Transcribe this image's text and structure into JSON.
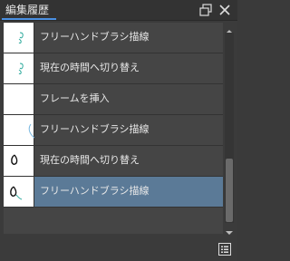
{
  "panel": {
    "title": "編集履歴"
  },
  "history": {
    "items": [
      {
        "label": "フリーハンドブラシ描線",
        "thumb": "small-green-stroke",
        "selected": false
      },
      {
        "label": "現在の時間へ切り替え",
        "thumb": "small-green-stroke",
        "selected": false
      },
      {
        "label": "フレームを挿入",
        "thumb": "blank",
        "selected": false
      },
      {
        "label": "フリーハンドブラシ描線",
        "thumb": "blue-curve",
        "selected": false
      },
      {
        "label": "現在の時間へ切り替え",
        "thumb": "black-loop",
        "selected": false
      },
      {
        "label": "フリーハンドブラシ描線",
        "thumb": "black-loop-with-stroke",
        "selected": true
      }
    ]
  },
  "colors": {
    "accent": "#4a90e2",
    "selected_row": "#5b7a97",
    "panel_bg": "#3b3b3b"
  },
  "icons": {
    "restore": "restore-window-icon",
    "close": "close-icon",
    "scroll_up": "chevron-up-icon",
    "scroll_down": "chevron-down-icon",
    "footer": "list-settings-icon"
  }
}
